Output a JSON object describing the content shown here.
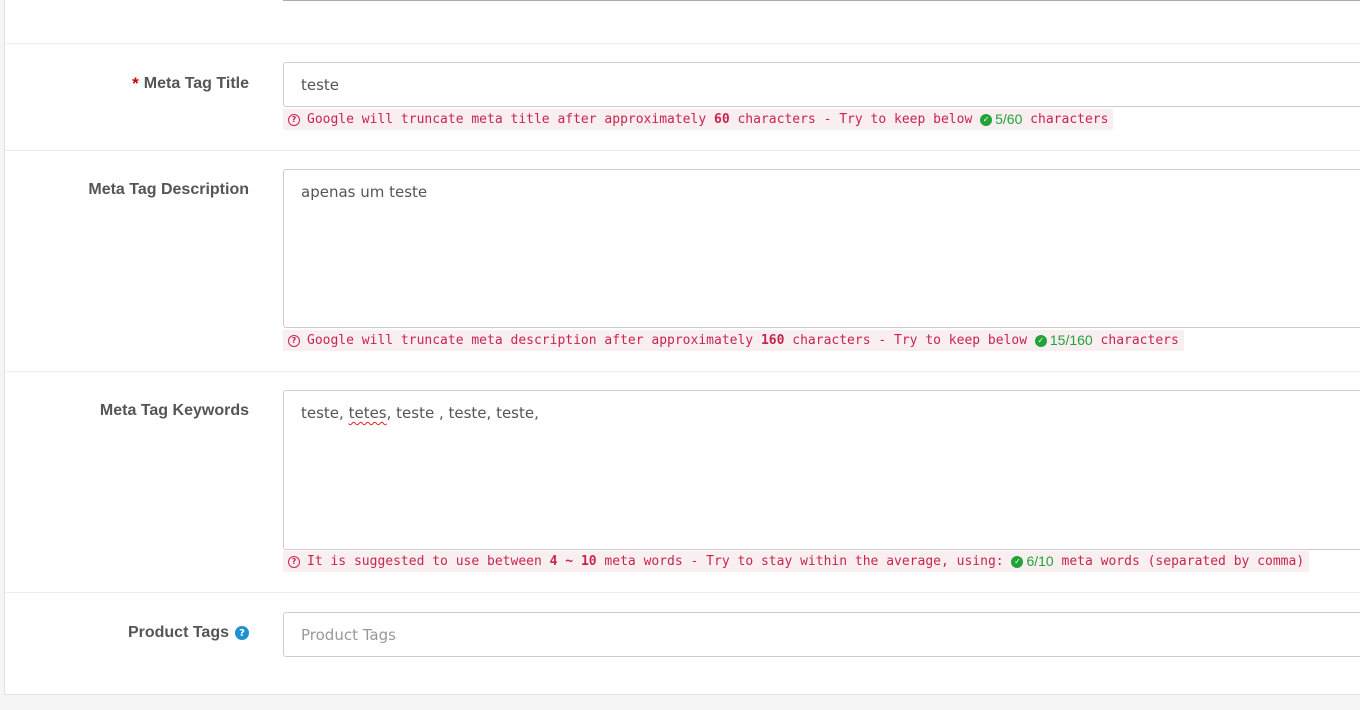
{
  "meta_title": {
    "required_mark": "*",
    "label": "Meta Tag Title",
    "value": "teste",
    "hint": {
      "q_glyph": "?",
      "prefix": "Google will truncate meta title after approximately ",
      "limit": "60",
      "middle": " characters - Try to keep below ",
      "check_glyph": "✓",
      "count": "5/60",
      "suffix": " characters"
    }
  },
  "meta_description": {
    "label": "Meta Tag Description",
    "value": "apenas um teste",
    "hint": {
      "q_glyph": "?",
      "prefix": "Google will truncate meta description after approximately ",
      "limit": "160",
      "middle": " characters - Try to keep below ",
      "check_glyph": "✓",
      "count": "15/160",
      "suffix": " characters"
    }
  },
  "meta_keywords": {
    "label": "Meta Tag Keywords",
    "value_parts": [
      "teste, ",
      "tetes",
      ", teste , teste, teste,"
    ],
    "hint": {
      "q_glyph": "?",
      "prefix": "It is suggested to use between ",
      "range": "4 ~ 10",
      "middle": " meta words - Try to stay within the average, using: ",
      "check_glyph": "✓",
      "count": "6/10",
      "suffix": " meta words (separated by comma)"
    }
  },
  "product_tags": {
    "label": "Product Tags",
    "help_glyph": "?",
    "placeholder": "Product Tags"
  },
  "colors": {
    "hint_text": "#c7254e",
    "hint_bg": "#f9eef0",
    "ok_green": "#22a33a",
    "required_red": "#cc0000",
    "help_blue": "#1e91cf"
  }
}
